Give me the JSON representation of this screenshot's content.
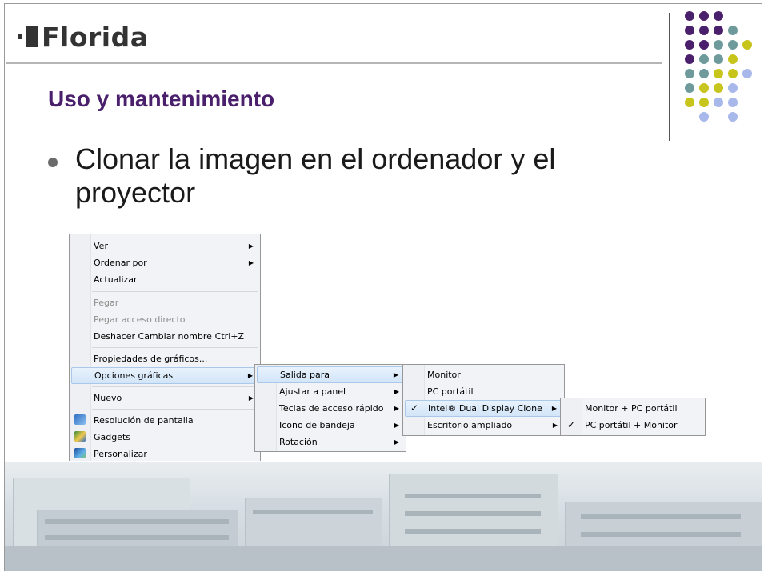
{
  "logo": {
    "text": "Florida"
  },
  "slide": {
    "subtitle": "Uso y mantenimiento",
    "bullet": "Clonar la imagen en el ordenador y el proyector"
  },
  "colors": {
    "purple": "#4a1f6b",
    "teal": "#6f9a9b",
    "olive": "#c7c41b",
    "lavender": "#a9b8ea"
  },
  "context_menu": {
    "items": [
      {
        "label": "Ver",
        "submenu": true
      },
      {
        "label": "Ordenar por",
        "submenu": true
      },
      {
        "label": "Actualizar"
      },
      {
        "label": "Pegar",
        "disabled": true
      },
      {
        "label": "Pegar acceso directo",
        "disabled": true
      },
      {
        "label": "Deshacer Cambiar nombre",
        "shortcut": "Ctrl+Z"
      },
      {
        "label": "Propiedades de gráficos..."
      },
      {
        "label": "Opciones gráficas",
        "submenu": true,
        "highlighted": true
      },
      {
        "label": "Nuevo",
        "submenu": true
      },
      {
        "label": "Resolución de pantalla",
        "icon": "display-icon"
      },
      {
        "label": "Gadgets",
        "icon": "gadgets-icon"
      },
      {
        "label": "Personalizar",
        "icon": "personalize-icon"
      }
    ]
  },
  "submenu_graficas": {
    "items": [
      {
        "label": "Salida para",
        "submenu": true,
        "highlighted": true
      },
      {
        "label": "Ajustar a panel",
        "submenu": true
      },
      {
        "label": "Teclas de acceso rápido",
        "submenu": true
      },
      {
        "label": "Icono de bandeja",
        "submenu": true
      },
      {
        "label": "Rotación",
        "submenu": true
      }
    ]
  },
  "submenu_salida": {
    "items": [
      {
        "label": "Monitor"
      },
      {
        "label": "PC portátil"
      },
      {
        "label": "Intel® Dual Display Clone",
        "submenu": true,
        "checked": true,
        "highlighted": true
      },
      {
        "label": "Escritorio ampliado",
        "submenu": true
      }
    ]
  },
  "submenu_clone": {
    "items": [
      {
        "label": "Monitor + PC portátil"
      },
      {
        "label": "PC portátil + Monitor",
        "checked": true
      }
    ]
  },
  "glyphs": {
    "arrow": "▶",
    "check": "✓"
  }
}
